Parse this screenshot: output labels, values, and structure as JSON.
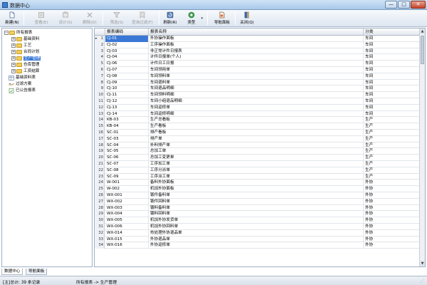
{
  "window": {
    "title": "数据中心",
    "min": "—",
    "max": "□",
    "close": "✕"
  },
  "toolbar": {
    "buttons": [
      {
        "label": "新建(N)",
        "icon": "new-doc-icon",
        "enabled": true
      },
      {
        "label": "查看(E)",
        "icon": "view-icon",
        "enabled": false
      },
      {
        "label": "设计(S)",
        "icon": "design-icon",
        "enabled": false
      },
      {
        "label": "删除(D)",
        "icon": "delete-icon",
        "enabled": false
      },
      {
        "label": "筛选(S)",
        "icon": "filter-icon",
        "enabled": false
      },
      {
        "label": "查询过滤(F)",
        "icon": "query-filter-icon",
        "enabled": false
      },
      {
        "label": "刷新(R)",
        "icon": "refresh-icon",
        "enabled": true
      },
      {
        "label": "类型",
        "icon": "type-icon",
        "enabled": true
      },
      {
        "label": "导航面板",
        "icon": "nav-panel-icon",
        "enabled": true
      },
      {
        "label": "关闭(Q)",
        "icon": "close-doc-icon",
        "enabled": true
      }
    ]
  },
  "tree": {
    "items": [
      {
        "label": "所有报表",
        "level": 0,
        "expander": "−",
        "kind": "folder"
      },
      {
        "label": "基础资料",
        "level": 1,
        "expander": "+",
        "kind": "folder"
      },
      {
        "label": "工艺",
        "level": 1,
        "expander": "+",
        "kind": "folder"
      },
      {
        "label": "合同计划",
        "level": 1,
        "expander": "+",
        "kind": "folder"
      },
      {
        "label": "生产管理",
        "level": 1,
        "expander": "+",
        "kind": "folder",
        "selected": true
      },
      {
        "label": "仓库管理",
        "level": 1,
        "expander": "+",
        "kind": "folder"
      },
      {
        "label": "工资结算",
        "level": 1,
        "expander": "+",
        "kind": "folder"
      },
      {
        "label": "基础资料表",
        "level": 0,
        "expander": "",
        "kind": "table"
      },
      {
        "label": "过滤方案",
        "level": 0,
        "expander": "",
        "kind": "filter"
      },
      {
        "label": "已公告报表",
        "level": 0,
        "expander": "",
        "kind": "report"
      }
    ]
  },
  "grid": {
    "columns": [
      "报表编码",
      "报表名称",
      "分类"
    ],
    "rows": [
      [
        "CJ-01",
        "外协操作面板",
        "车间"
      ],
      [
        "CJ-02",
        "工序操作面板",
        "车间"
      ],
      [
        "CJ-03",
        "非正常计件日报表",
        "车间"
      ],
      [
        "CJ-04",
        "计件日报单(个人)",
        "车间"
      ],
      [
        "CJ-06",
        "计件日工日报",
        "车间"
      ],
      [
        "CJ-07",
        "车间领用单",
        "车间"
      ],
      [
        "CJ-08",
        "车间领料单",
        "车间"
      ],
      [
        "CJ-09",
        "车间退料单",
        "车间"
      ],
      [
        "CJ-10",
        "车间退品明细",
        "车间"
      ],
      [
        "CJ-11",
        "车间领料明细",
        "车间"
      ],
      [
        "CJ-12",
        "车间小组退品明细",
        "车间"
      ],
      [
        "CJ-13",
        "车间返修单",
        "车间"
      ],
      [
        "CJ-14",
        "车间返修明细",
        "车间"
      ],
      [
        "KB-03",
        "生产总看板",
        "生产"
      ],
      [
        "KB-04",
        "生产看板",
        "生产"
      ],
      [
        "SC-01",
        "排产看板",
        "生产"
      ],
      [
        "SC-03",
        "排产单",
        "生产"
      ],
      [
        "SC-04",
        "补料排产单",
        "生产"
      ],
      [
        "SC-05",
        "总加工单",
        "生产"
      ],
      [
        "SC-06",
        "总加工变更单",
        "生产"
      ],
      [
        "SC-07",
        "工序加工单",
        "生产"
      ],
      [
        "SC-08",
        "工序分派单",
        "生产"
      ],
      [
        "SC-09",
        "工序派工单",
        "生产"
      ],
      [
        "W-001",
        "备料外协面板",
        "外协"
      ],
      [
        "W-002",
        "机加外协面板",
        "外协"
      ],
      [
        "WX-001",
        "锻件备料单",
        "外协"
      ],
      [
        "WX-002",
        "锻件回料单",
        "外协"
      ],
      [
        "WX-003",
        "镀料备料单",
        "外协"
      ],
      [
        "WX-004",
        "镀料回料单",
        "外协"
      ],
      [
        "WX-005",
        "机加外协发货单",
        "外协"
      ],
      [
        "WX-006",
        "机加外协回料单",
        "外协"
      ],
      [
        "WX-014",
        "热处理外协退品单",
        "外协"
      ],
      [
        "WX-015",
        "外协退品单",
        "外协"
      ],
      [
        "WX-016",
        "外协返修单",
        "外协"
      ]
    ]
  },
  "tabs": [
    "数据中心",
    "导航面板"
  ],
  "status": {
    "count": "[主]总计: 39 条记录",
    "path": "所有报表 -> 生产管理"
  },
  "colors": {
    "selection": "#3a78d6",
    "folder": "#f1cf5c",
    "titlebar": "#a9c8ea"
  }
}
